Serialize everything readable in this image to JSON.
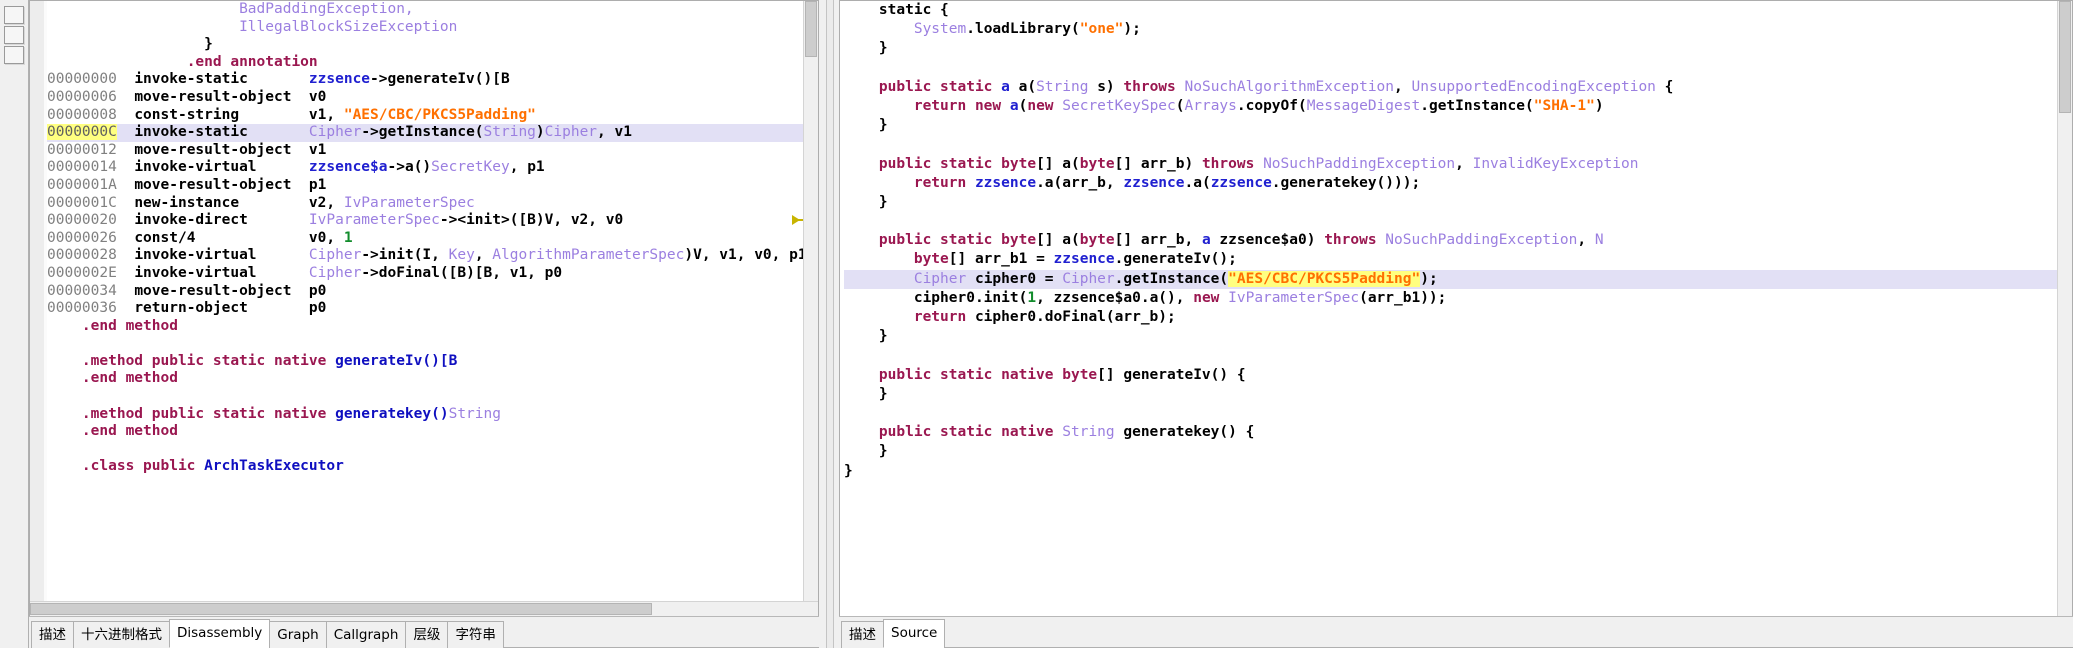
{
  "left_rail": {
    "buttons": [
      "rail-button-1",
      "rail-button-2",
      "rail-button-3"
    ]
  },
  "disassembly_pane": {
    "breakpoint_address": "0000000C",
    "highlighted_address": "0000000C",
    "lines": [
      {
        "indent": 22,
        "segs": [
          {
            "t": "BadPaddingException,",
            "c": "type"
          }
        ]
      },
      {
        "indent": 22,
        "segs": [
          {
            "t": "IllegalBlockSizeException",
            "c": "type"
          }
        ]
      },
      {
        "indent": 18,
        "segs": [
          {
            "t": "}",
            "c": "plain"
          }
        ]
      },
      {
        "indent": 16,
        "segs": [
          {
            "t": ".end annotation",
            "c": "dir"
          }
        ]
      },
      {
        "addr": "00000000",
        "mnem": "invoke-static",
        "segs": [
          {
            "t": "zzsence",
            "c": "cls"
          },
          {
            "t": "->generateIv()[B",
            "c": "plain"
          }
        ]
      },
      {
        "addr": "00000006",
        "mnem": "move-result-object",
        "segs": [
          {
            "t": "v0",
            "c": "plain"
          }
        ]
      },
      {
        "addr": "00000008",
        "mnem": "const-string",
        "segs": [
          {
            "t": "v1, ",
            "c": "plain"
          },
          {
            "t": "\"AES/CBC/PKCS5Padding\"",
            "c": "str"
          }
        ]
      },
      {
        "addr": "0000000C",
        "mnem": "invoke-static",
        "breakpoint": true,
        "highlight": true,
        "segs": [
          {
            "t": "Cipher",
            "c": "type"
          },
          {
            "t": "->getInstance(",
            "c": "plain"
          },
          {
            "t": "String",
            "c": "type"
          },
          {
            "t": ")",
            "c": "plain"
          },
          {
            "t": "Cipher",
            "c": "type"
          },
          {
            "t": ", v1",
            "c": "plain"
          }
        ]
      },
      {
        "addr": "00000012",
        "mnem": "move-result-object",
        "segs": [
          {
            "t": "v1",
            "c": "plain"
          }
        ]
      },
      {
        "addr": "00000014",
        "mnem": "invoke-virtual",
        "segs": [
          {
            "t": "zzsence$a",
            "c": "cls"
          },
          {
            "t": "->a()",
            "c": "plain"
          },
          {
            "t": "SecretKey",
            "c": "type"
          },
          {
            "t": ", p1",
            "c": "plain"
          }
        ]
      },
      {
        "addr": "0000001A",
        "mnem": "move-result-object",
        "segs": [
          {
            "t": "p1",
            "c": "plain"
          }
        ]
      },
      {
        "addr": "0000001C",
        "mnem": "new-instance",
        "segs": [
          {
            "t": "v2, ",
            "c": "plain"
          },
          {
            "t": "IvParameterSpec",
            "c": "type"
          }
        ]
      },
      {
        "addr": "00000020",
        "mnem": "invoke-direct",
        "segs": [
          {
            "t": "IvParameterSpec",
            "c": "type"
          },
          {
            "t": "-><init>([B)V, v2, v0",
            "c": "plain"
          }
        ]
      },
      {
        "addr": "00000026",
        "mnem": "const/4",
        "segs": [
          {
            "t": "v0, ",
            "c": "plain"
          },
          {
            "t": "1",
            "c": "num"
          }
        ]
      },
      {
        "addr": "00000028",
        "mnem": "invoke-virtual",
        "segs": [
          {
            "t": "Cipher",
            "c": "type"
          },
          {
            "t": "->init(I, ",
            "c": "plain"
          },
          {
            "t": "Key",
            "c": "type"
          },
          {
            "t": ", ",
            "c": "plain"
          },
          {
            "t": "AlgorithmParameterSpec",
            "c": "type"
          },
          {
            "t": ")V, v1, v0, p1",
            "c": "plain"
          }
        ]
      },
      {
        "addr": "0000002E",
        "mnem": "invoke-virtual",
        "segs": [
          {
            "t": "Cipher",
            "c": "type"
          },
          {
            "t": "->doFinal([B)[B, v1, p0",
            "c": "plain"
          }
        ]
      },
      {
        "addr": "00000034",
        "mnem": "move-result-object",
        "segs": [
          {
            "t": "p0",
            "c": "plain"
          }
        ]
      },
      {
        "addr": "00000036",
        "mnem": "return-object",
        "segs": [
          {
            "t": "p0",
            "c": "plain"
          }
        ]
      },
      {
        "indent": 4,
        "segs": [
          {
            "t": ".end method",
            "c": "dir"
          }
        ]
      },
      {
        "indent": 0,
        "segs": []
      },
      {
        "indent": 4,
        "segs": [
          {
            "t": ".method public static native ",
            "c": "dir"
          },
          {
            "t": "generateIv()[B",
            "c": "clsb"
          }
        ]
      },
      {
        "indent": 4,
        "segs": [
          {
            "t": ".end method",
            "c": "dir"
          }
        ]
      },
      {
        "indent": 0,
        "segs": []
      },
      {
        "indent": 4,
        "segs": [
          {
            "t": ".method public static native ",
            "c": "dir"
          },
          {
            "t": "generatekey()",
            "c": "clsb"
          },
          {
            "t": "String",
            "c": "type"
          }
        ]
      },
      {
        "indent": 4,
        "segs": [
          {
            "t": ".end method",
            "c": "dir"
          }
        ]
      },
      {
        "indent": 0,
        "segs": []
      },
      {
        "indent": 4,
        "segs": [
          {
            "t": ".class public ",
            "c": "dir"
          },
          {
            "t": "ArchTaskExecutor",
            "c": "clsb"
          }
        ]
      }
    ],
    "tabs": [
      {
        "label": "描述",
        "active": false
      },
      {
        "label": "十六进制格式",
        "active": false
      },
      {
        "label": "Disassembly",
        "active": true
      },
      {
        "label": "Graph",
        "active": false
      },
      {
        "label": "Callgraph",
        "active": false
      },
      {
        "label": "层级",
        "active": false
      },
      {
        "label": "字符串",
        "active": false
      }
    ]
  },
  "source_pane": {
    "highlighted_string": "\"AES/CBC/PKCS5Padding\"",
    "lines": [
      {
        "indent": 4,
        "segs": [
          {
            "t": "static {",
            "c": "plain"
          }
        ]
      },
      {
        "indent": 8,
        "segs": [
          {
            "t": "System",
            "c": "type"
          },
          {
            "t": ".loadLibrary(",
            "c": "plain"
          },
          {
            "t": "\"one\"",
            "c": "str"
          },
          {
            "t": ");",
            "c": "plain"
          }
        ]
      },
      {
        "indent": 4,
        "segs": [
          {
            "t": "}",
            "c": "plain"
          }
        ]
      },
      {
        "indent": 0,
        "segs": []
      },
      {
        "indent": 4,
        "segs": [
          {
            "t": "public static ",
            "c": "dir"
          },
          {
            "t": "a",
            "c": "cls"
          },
          {
            "t": " a(",
            "c": "plain"
          },
          {
            "t": "String",
            "c": "type"
          },
          {
            "t": " s) ",
            "c": "plain"
          },
          {
            "t": "throws ",
            "c": "dir"
          },
          {
            "t": "NoSuchAlgorithmException",
            "c": "type"
          },
          {
            "t": ", ",
            "c": "plain"
          },
          {
            "t": "UnsupportedEncodingException",
            "c": "type"
          },
          {
            "t": " {",
            "c": "plain"
          }
        ]
      },
      {
        "indent": 8,
        "segs": [
          {
            "t": "return new ",
            "c": "dir"
          },
          {
            "t": "a",
            "c": "cls"
          },
          {
            "t": "(",
            "c": "plain"
          },
          {
            "t": "new ",
            "c": "dir"
          },
          {
            "t": "SecretKeySpec",
            "c": "type"
          },
          {
            "t": "(",
            "c": "plain"
          },
          {
            "t": "Arrays",
            "c": "type"
          },
          {
            "t": ".copyOf(",
            "c": "plain"
          },
          {
            "t": "MessageDigest",
            "c": "type"
          },
          {
            "t": ".getInstance(",
            "c": "plain"
          },
          {
            "t": "\"SHA-1\"",
            "c": "str"
          },
          {
            "t": ")",
            "c": "plain"
          }
        ]
      },
      {
        "indent": 4,
        "segs": [
          {
            "t": "}",
            "c": "plain"
          }
        ]
      },
      {
        "indent": 0,
        "segs": []
      },
      {
        "indent": 4,
        "segs": [
          {
            "t": "public static byte",
            "c": "dir"
          },
          {
            "t": "[] a(",
            "c": "plain"
          },
          {
            "t": "byte",
            "c": "dir"
          },
          {
            "t": "[] arr_b) ",
            "c": "plain"
          },
          {
            "t": "throws ",
            "c": "dir"
          },
          {
            "t": "NoSuchPaddingException",
            "c": "type"
          },
          {
            "t": ", ",
            "c": "plain"
          },
          {
            "t": "InvalidKeyException",
            "c": "type"
          }
        ]
      },
      {
        "indent": 8,
        "segs": [
          {
            "t": "return ",
            "c": "dir"
          },
          {
            "t": "zzsence",
            "c": "cls"
          },
          {
            "t": ".a(arr_b, ",
            "c": "plain"
          },
          {
            "t": "zzsence",
            "c": "cls"
          },
          {
            "t": ".a(",
            "c": "plain"
          },
          {
            "t": "zzsence",
            "c": "cls"
          },
          {
            "t": ".generatekey()));",
            "c": "plain"
          }
        ]
      },
      {
        "indent": 4,
        "segs": [
          {
            "t": "}",
            "c": "plain"
          }
        ]
      },
      {
        "indent": 0,
        "segs": []
      },
      {
        "indent": 4,
        "segs": [
          {
            "t": "public static byte",
            "c": "dir"
          },
          {
            "t": "[] a(",
            "c": "plain"
          },
          {
            "t": "byte",
            "c": "dir"
          },
          {
            "t": "[] arr_b, ",
            "c": "plain"
          },
          {
            "t": "a",
            "c": "cls"
          },
          {
            "t": " zzsence$a0) ",
            "c": "plain"
          },
          {
            "t": "throws ",
            "c": "dir"
          },
          {
            "t": "NoSuchPaddingException",
            "c": "type"
          },
          {
            "t": ", ",
            "c": "plain"
          },
          {
            "t": "N",
            "c": "type"
          }
        ]
      },
      {
        "indent": 8,
        "segs": [
          {
            "t": "byte",
            "c": "dir"
          },
          {
            "t": "[] arr_b1 = ",
            "c": "plain"
          },
          {
            "t": "zzsence",
            "c": "cls"
          },
          {
            "t": ".generateIv();",
            "c": "plain"
          }
        ]
      },
      {
        "indent": 8,
        "highlight": true,
        "segs": [
          {
            "t": "Cipher",
            "c": "type"
          },
          {
            "t": " cipher0 = ",
            "c": "plain"
          },
          {
            "t": "Cipher",
            "c": "type"
          },
          {
            "t": ".getInstance(",
            "c": "plain"
          },
          {
            "t": "\"AES/CBC/PKCS5Padding\"",
            "c": "hlstr"
          },
          {
            "t": ");",
            "c": "plain"
          }
        ]
      },
      {
        "indent": 8,
        "segs": [
          {
            "t": "cipher0.init(",
            "c": "plain"
          },
          {
            "t": "1",
            "c": "num"
          },
          {
            "t": ", zzsence$a0.a(), ",
            "c": "plain"
          },
          {
            "t": "new ",
            "c": "dir"
          },
          {
            "t": "IvParameterSpec",
            "c": "type"
          },
          {
            "t": "(arr_b1));",
            "c": "plain"
          }
        ]
      },
      {
        "indent": 8,
        "segs": [
          {
            "t": "return ",
            "c": "dir"
          },
          {
            "t": "cipher0.doFinal(arr_b);",
            "c": "plain"
          }
        ]
      },
      {
        "indent": 4,
        "segs": [
          {
            "t": "}",
            "c": "plain"
          }
        ]
      },
      {
        "indent": 0,
        "segs": []
      },
      {
        "indent": 4,
        "segs": [
          {
            "t": "public static native byte",
            "c": "dir"
          },
          {
            "t": "[] generateIv() {",
            "c": "plain"
          }
        ]
      },
      {
        "indent": 4,
        "segs": [
          {
            "t": "}",
            "c": "plain"
          }
        ]
      },
      {
        "indent": 0,
        "segs": []
      },
      {
        "indent": 4,
        "segs": [
          {
            "t": "public static native ",
            "c": "dir"
          },
          {
            "t": "String",
            "c": "type"
          },
          {
            "t": " generatekey() {",
            "c": "plain"
          }
        ]
      },
      {
        "indent": 4,
        "segs": [
          {
            "t": "}",
            "c": "plain"
          }
        ]
      },
      {
        "indent": 0,
        "segs": [
          {
            "t": "}",
            "c": "plain"
          }
        ]
      }
    ],
    "tabs": [
      {
        "label": "描述",
        "active": false
      },
      {
        "label": "Source",
        "active": true
      }
    ]
  },
  "colors": {
    "highlight_line": "#e2e0f5",
    "highlight_text": "#ffff80",
    "breakpoint": "#e03030",
    "string": "#ff7000",
    "type": "#9b7fe0",
    "directive": "#9a1750",
    "class": "#2020d0",
    "number": "#128c2c",
    "address": "#808080"
  }
}
